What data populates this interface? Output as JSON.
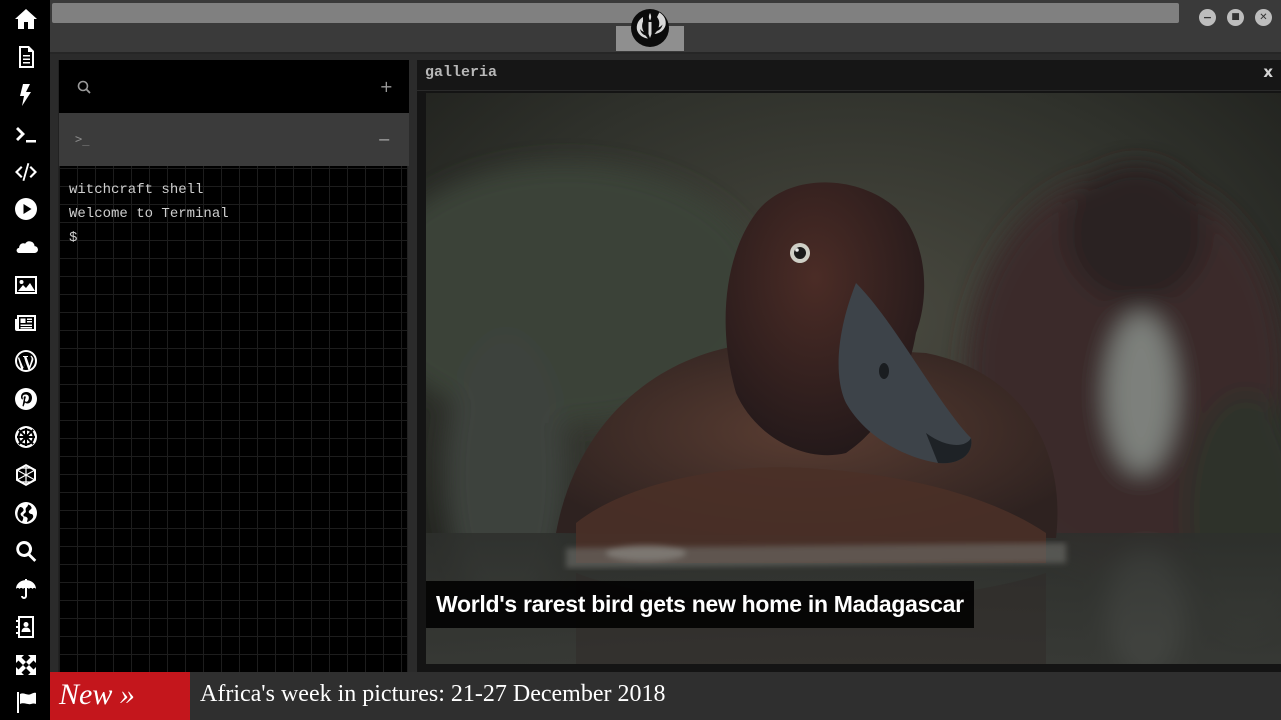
{
  "sidebar": {
    "icons": [
      "home-icon",
      "document-icon",
      "bolt-icon",
      "terminal-icon",
      "code-icon",
      "play-icon",
      "cloud-icon",
      "image-icon",
      "newspaper-icon",
      "wordpress-icon",
      "pinterest-icon",
      "galactic-empire-icon",
      "hexagon-network-icon",
      "globe-icon",
      "search-icon",
      "umbrella-icon",
      "address-book-icon",
      "expand-icon",
      "flag-icon"
    ]
  },
  "window": {
    "logo": "rebel-alliance-icon",
    "controls": {
      "minimize": "−",
      "maximize": "■",
      "close": "✕"
    }
  },
  "terminal": {
    "add_label": "+",
    "tab_prompt": ">_",
    "tab_minimize": "−",
    "lines": [
      "witchcraft shell",
      "Welcome to Terminal",
      "$"
    ]
  },
  "galleria": {
    "title": "galleria",
    "close_label": "x",
    "caption": "World's rarest bird gets new home in Madagascar"
  },
  "ticker": {
    "badge": "New »",
    "headline": "Africa's week in pictures: 21-27 December 2018"
  },
  "colors": {
    "accent_red": "#c4161c",
    "panel_black": "#000000",
    "chrome_gray": "#3a3a3a"
  }
}
